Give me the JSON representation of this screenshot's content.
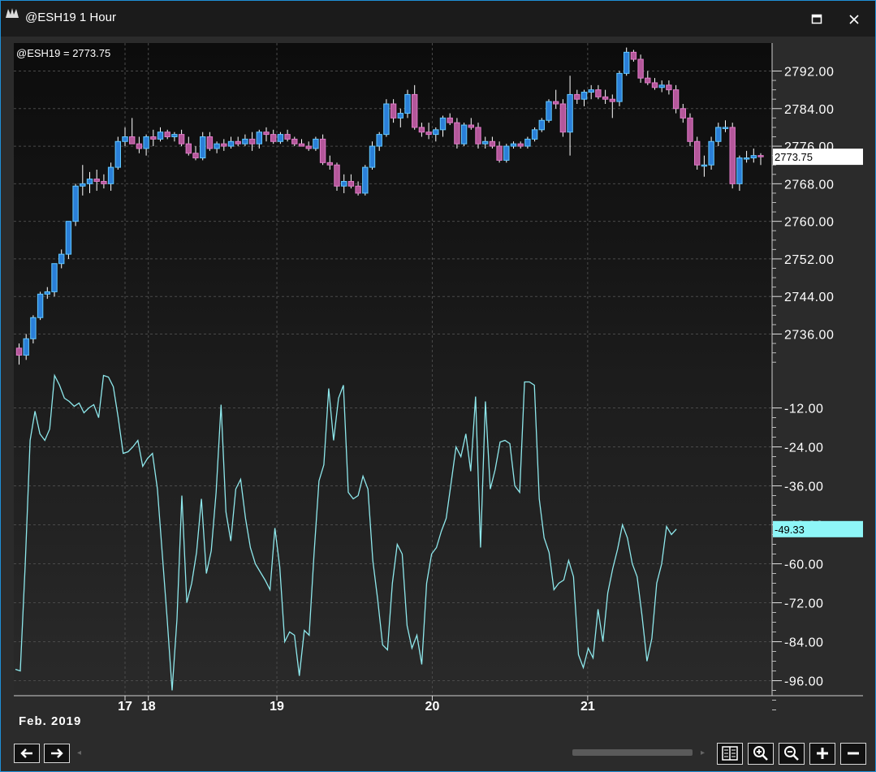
{
  "window": {
    "title": "@ESH19 1 Hour"
  },
  "chart_data": [
    {
      "type": "candlestick",
      "symbol_label": "@ESH19 = 2773.75",
      "last_value_label": "2773.75",
      "y_ticks": [
        "2792.00",
        "2784.00",
        "2776.00",
        "2768.00",
        "2760.00",
        "2752.00",
        "2744.00",
        "2736.00"
      ],
      "y_tick_values": [
        2792,
        2784,
        2776,
        2768,
        2760,
        2752,
        2744,
        2736
      ],
      "ylim": [
        2731.5,
        2797
      ],
      "last_value": 2773.75,
      "grid": true,
      "colors": {
        "up_body": "#2a7fd8",
        "up_border": "#61c8ff",
        "down_body": "#b4579a",
        "down_border": "#e07ac8",
        "wick": "#ffffff"
      },
      "ohlc": [
        [
          2733,
          2734,
          2729.5,
          2731.5
        ],
        [
          2731.5,
          2736,
          2730.5,
          2735
        ],
        [
          2735,
          2740,
          2734,
          2739.5
        ],
        [
          2739.5,
          2745,
          2739,
          2744.5
        ],
        [
          2744.5,
          2746,
          2743.5,
          2745
        ],
        [
          2745,
          2751,
          2744,
          2751
        ],
        [
          2751,
          2754,
          2750,
          2753
        ],
        [
          2753,
          2760,
          2752,
          2760
        ],
        [
          2760,
          2768,
          2759,
          2767.5
        ],
        [
          2767.5,
          2772,
          2765.5,
          2768
        ],
        [
          2768,
          2770.5,
          2766,
          2769
        ],
        [
          2769,
          2771,
          2766.5,
          2768.5
        ],
        [
          2768.5,
          2770,
          2767,
          2768
        ],
        [
          2768,
          2772.5,
          2766.5,
          2771.5
        ],
        [
          2771.5,
          2778,
          2771,
          2777
        ],
        [
          2777,
          2780,
          2776,
          2778
        ],
        [
          2778,
          2782,
          2776.5,
          2776.5
        ],
        [
          2776.5,
          2778,
          2774.5,
          2775.5
        ],
        [
          2775.5,
          2778.5,
          2774,
          2778
        ],
        [
          2778,
          2779.5,
          2776,
          2777.5
        ],
        [
          2777.5,
          2780,
          2777,
          2779
        ],
        [
          2779,
          2779.5,
          2777.5,
          2778
        ],
        [
          2778,
          2779,
          2777,
          2778.5
        ],
        [
          2778.5,
          2779.5,
          2776,
          2776.5
        ],
        [
          2776.5,
          2778,
          2774,
          2774.5
        ],
        [
          2774.5,
          2776,
          2773,
          2773.5
        ],
        [
          2773.5,
          2779,
          2773,
          2778
        ],
        [
          2778,
          2779,
          2775,
          2775.5
        ],
        [
          2775.5,
          2777,
          2774.5,
          2776.5
        ],
        [
          2776.5,
          2777.5,
          2775,
          2776
        ],
        [
          2776,
          2778,
          2775.5,
          2777
        ],
        [
          2777,
          2778,
          2776,
          2776.5
        ],
        [
          2776.5,
          2778.5,
          2776,
          2777.5
        ],
        [
          2777.5,
          2779,
          2775,
          2776.5
        ],
        [
          2776.5,
          2779.5,
          2775.5,
          2779
        ],
        [
          2779,
          2780,
          2777,
          2778.5
        ],
        [
          2778.5,
          2779.5,
          2776.5,
          2777
        ],
        [
          2777,
          2779,
          2776.5,
          2778.5
        ],
        [
          2778.5,
          2779.5,
          2777,
          2777.5
        ],
        [
          2777.5,
          2778,
          2776,
          2776.5
        ],
        [
          2776.5,
          2777.5,
          2776,
          2776
        ],
        [
          2776,
          2777,
          2775,
          2775.5
        ],
        [
          2775.5,
          2778,
          2775,
          2777.5
        ],
        [
          2777.5,
          2778.5,
          2772,
          2772.5
        ],
        [
          2772.5,
          2774,
          2771,
          2772
        ],
        [
          2772,
          2772.5,
          2766.5,
          2767.5
        ],
        [
          2767.5,
          2770,
          2766,
          2768.5
        ],
        [
          2768.5,
          2770,
          2767,
          2767.5
        ],
        [
          2767.5,
          2768.5,
          2765.5,
          2766
        ],
        [
          2766,
          2772,
          2765.5,
          2771.5
        ],
        [
          2771.5,
          2777,
          2771,
          2776
        ],
        [
          2776,
          2779,
          2775,
          2778.5
        ],
        [
          2778.5,
          2786,
          2778,
          2785
        ],
        [
          2785,
          2786,
          2781,
          2782
        ],
        [
          2782,
          2784,
          2780,
          2783
        ],
        [
          2783,
          2788,
          2782,
          2787
        ],
        [
          2787,
          2789,
          2779.5,
          2780
        ],
        [
          2780,
          2781,
          2778,
          2779
        ],
        [
          2779,
          2781,
          2777.5,
          2778.5
        ],
        [
          2778.5,
          2780,
          2777,
          2779.5
        ],
        [
          2779.5,
          2782.5,
          2778,
          2782
        ],
        [
          2782,
          2783,
          2780.5,
          2781
        ],
        [
          2781,
          2782,
          2775.5,
          2776.5
        ],
        [
          2776.5,
          2781,
          2776,
          2780.5
        ],
        [
          2780.5,
          2782,
          2779.5,
          2780
        ],
        [
          2780,
          2781,
          2775.5,
          2776.5
        ],
        [
          2776.5,
          2778,
          2775.5,
          2777
        ],
        [
          2777,
          2778,
          2775.5,
          2776
        ],
        [
          2776,
          2777,
          2772.5,
          2773
        ],
        [
          2773,
          2776.5,
          2772.5,
          2776
        ],
        [
          2776,
          2777,
          2775.5,
          2776.5
        ],
        [
          2776.5,
          2777,
          2775.5,
          2776
        ],
        [
          2776,
          2778,
          2775.5,
          2777.5
        ],
        [
          2777.5,
          2780,
          2777,
          2779.5
        ],
        [
          2779.5,
          2782,
          2779,
          2781.5
        ],
        [
          2781.5,
          2786,
          2781,
          2785.5
        ],
        [
          2785.5,
          2788,
          2784,
          2785
        ],
        [
          2785,
          2786,
          2778,
          2779
        ],
        [
          2779,
          2791,
          2774,
          2787
        ],
        [
          2787,
          2788,
          2785,
          2786
        ],
        [
          2786,
          2788,
          2784.5,
          2787.5
        ],
        [
          2787.5,
          2789,
          2786,
          2788
        ],
        [
          2788,
          2789,
          2786,
          2786.5
        ],
        [
          2786.5,
          2788,
          2785,
          2786
        ],
        [
          2786,
          2787,
          2782,
          2785.5
        ],
        [
          2785.5,
          2792,
          2784.5,
          2791.5
        ],
        [
          2791.5,
          2797,
          2791,
          2796
        ],
        [
          2796,
          2796.5,
          2794,
          2794.5
        ],
        [
          2794.5,
          2795.5,
          2789.5,
          2790.5
        ],
        [
          2790.5,
          2792,
          2789,
          2789.5
        ],
        [
          2789.5,
          2790.5,
          2788,
          2788.5
        ],
        [
          2788.5,
          2790,
          2787.5,
          2789
        ],
        [
          2789,
          2790,
          2787,
          2788
        ],
        [
          2788,
          2789,
          2783,
          2784
        ],
        [
          2784,
          2785,
          2781,
          2782
        ],
        [
          2782,
          2783,
          2776,
          2777
        ],
        [
          2777,
          2778,
          2771,
          2772
        ],
        [
          2772,
          2774,
          2769.5,
          2772
        ],
        [
          2772,
          2778,
          2771,
          2777
        ],
        [
          2777,
          2781,
          2776,
          2780
        ],
        [
          2780,
          2781.5,
          2779,
          2780
        ],
        [
          2780,
          2781,
          2767,
          2768
        ],
        [
          2768,
          2774,
          2766.5,
          2773.5
        ],
        [
          2773.5,
          2775,
          2772.5,
          2773.5
        ],
        [
          2773.5,
          2775.5,
          2772.5,
          2774
        ],
        [
          2774,
          2774.5,
          2772,
          2773.75
        ]
      ]
    },
    {
      "type": "line",
      "last_value_label": "-49.33",
      "y_ticks": [
        "-12.00",
        "-24.00",
        "-36.00",
        "-48.00",
        "-60.00",
        "-72.00",
        "-84.00",
        "-96.00"
      ],
      "y_tick_values": [
        -12,
        -24,
        -36,
        -48,
        -60,
        -72,
        -84,
        -96
      ],
      "ylim": [
        -99.5,
        2
      ],
      "last_value": -49.33,
      "color": "#8ee8ec",
      "values": [
        -92.5,
        -93,
        -60,
        -22,
        -13,
        -20,
        -22,
        -18.5,
        -2,
        -5,
        -9,
        -10,
        -11.5,
        -10.5,
        -13.5,
        -12,
        -11,
        -15,
        -2,
        -2.5,
        -5.5,
        -15,
        -26,
        -25.5,
        -24,
        -22,
        -30,
        -27.5,
        -26,
        -37,
        -57,
        -77,
        -99,
        -77,
        -39,
        -72,
        -66,
        -56.5,
        -40,
        -63,
        -56,
        -38,
        -11,
        -44,
        -53,
        -37,
        -34,
        -46,
        -55,
        -60,
        -62.5,
        -65,
        -68,
        -49,
        -61,
        -84,
        -81,
        -82,
        -94.5,
        -80.5,
        -82,
        -57,
        -34.5,
        -29.5,
        -6,
        -22,
        -9,
        -5,
        -38,
        -40,
        -39,
        -33,
        -37,
        -59,
        -71,
        -85,
        -86.5,
        -66,
        -54,
        -57,
        -79,
        -86,
        -82,
        -91,
        -66,
        -57,
        -55,
        -50,
        -46,
        -35,
        -24,
        -27,
        -20,
        -31.5,
        -8.5,
        -55,
        -10,
        -37,
        -31,
        -22.5,
        -22,
        -23,
        -36,
        -38,
        -4,
        -4,
        -5,
        -40,
        -52,
        -56.5,
        -68,
        -66,
        -65,
        -59,
        -64,
        -88,
        -92,
        -86,
        -89,
        -74,
        -84,
        -69,
        -61.5,
        -55.5,
        -48,
        -52,
        -60,
        -64,
        -76,
        -90,
        -83,
        -66,
        -60,
        -48.5,
        -51,
        -49.33
      ]
    }
  ],
  "x_axis": {
    "labels": [
      {
        "text": "17",
        "bar": 15
      },
      {
        "text": "18",
        "bar": 18.3
      },
      {
        "text": "19",
        "bar": 36.5
      },
      {
        "text": "20",
        "bar": 58.5
      },
      {
        "text": "21",
        "bar": 80.5
      }
    ],
    "month_label": "Feb. 2019"
  },
  "toolbar": {
    "left_arrow_icon": "arrow-left-icon",
    "right_arrow_icon": "arrow-right-icon",
    "split_icon": "split-panes-icon",
    "zoom_in_icon": "zoom-in-icon",
    "zoom_out_icon": "zoom-out-icon",
    "plus_icon": "plus-icon",
    "minus_icon": "minus-icon"
  }
}
